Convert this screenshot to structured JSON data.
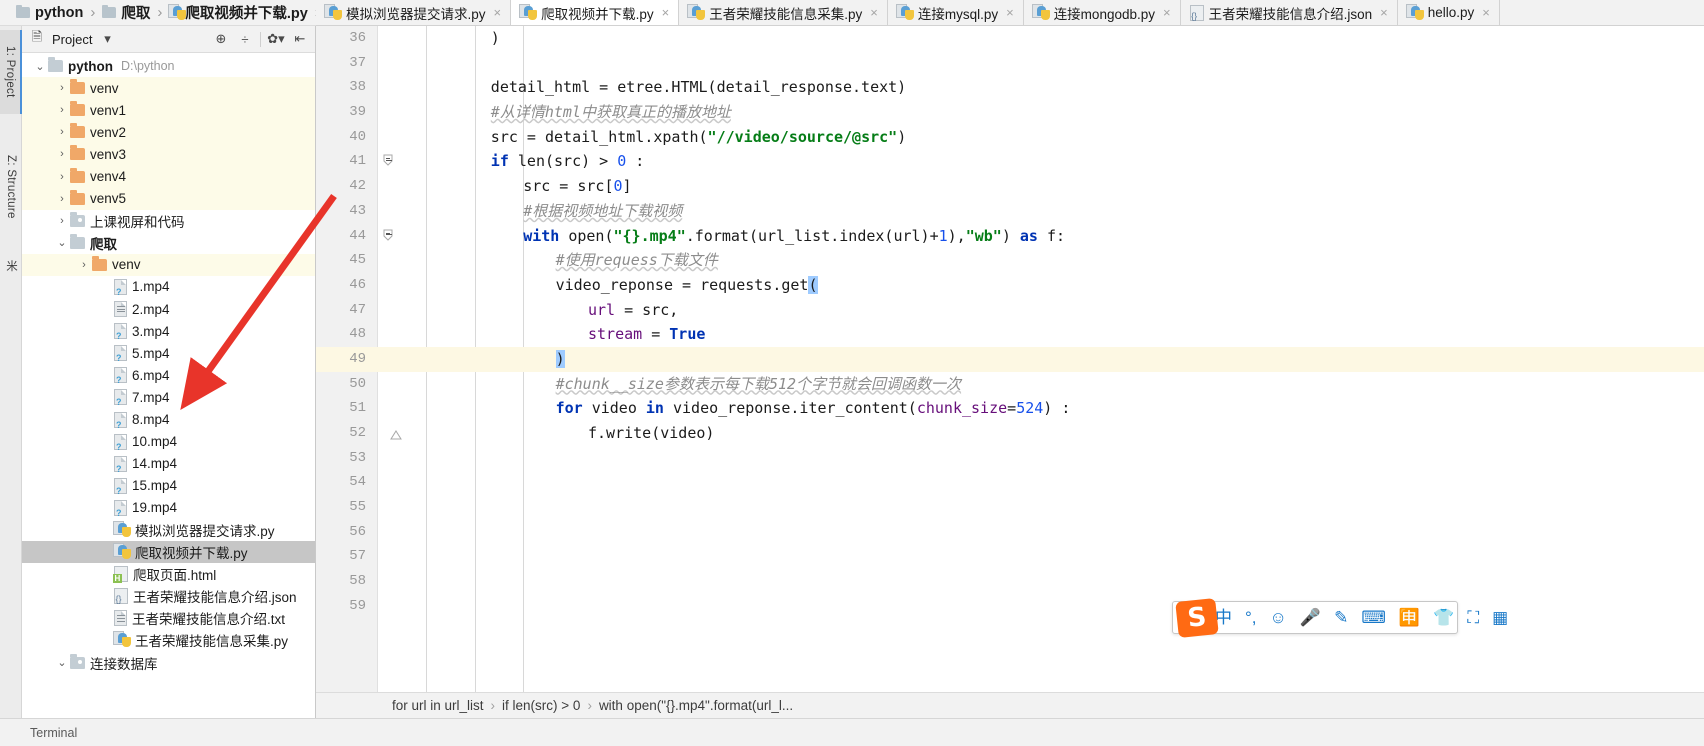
{
  "breadcrumb": {
    "items": [
      {
        "label": "python",
        "icon": "folder-icon"
      },
      {
        "label": "爬取",
        "icon": "folder-icon"
      },
      {
        "label": "爬取视频并下载.py",
        "icon": "python-file-icon"
      }
    ],
    "separator": "›"
  },
  "corner_tab": {
    "label": "连接mo"
  },
  "rail": {
    "project": "1: Project",
    "structure": "Z: Structure",
    "favorites": "米"
  },
  "panel": {
    "title": "Project",
    "dropdown_caret": "▾",
    "icons": [
      "target-icon",
      "collapse-all-icon",
      "gear-icon",
      "hide-panel-icon"
    ]
  },
  "tree": [
    {
      "id": "python-root",
      "label": "python",
      "path": "D:\\python",
      "indent": 0,
      "arrow": "⌄",
      "icon": "folder-closed",
      "bold": true,
      "bg": "none"
    },
    {
      "id": "venv",
      "label": "venv",
      "indent": 1,
      "arrow": "›",
      "icon": "folder-orange",
      "bg": "venv"
    },
    {
      "id": "venv1",
      "label": "venv1",
      "indent": 1,
      "arrow": "›",
      "icon": "folder-orange",
      "bg": "venv"
    },
    {
      "id": "venv2",
      "label": "venv2",
      "indent": 1,
      "arrow": "›",
      "icon": "folder-orange",
      "bg": "venv"
    },
    {
      "id": "venv3",
      "label": "venv3",
      "indent": 1,
      "arrow": "›",
      "icon": "folder-orange",
      "bg": "venv"
    },
    {
      "id": "venv4",
      "label": "venv4",
      "indent": 1,
      "arrow": "›",
      "icon": "folder-orange",
      "bg": "venv"
    },
    {
      "id": "venv5",
      "label": "venv5",
      "indent": 1,
      "arrow": "›",
      "icon": "folder-orange",
      "bg": "venv"
    },
    {
      "id": "shangke",
      "label": "上课视屏和代码",
      "indent": 1,
      "arrow": "›",
      "icon": "folder-module",
      "bg": "none"
    },
    {
      "id": "paqu",
      "label": "爬取",
      "indent": 1,
      "arrow": "⌄",
      "icon": "folder-closed",
      "bold": true,
      "bg": "none"
    },
    {
      "id": "paqu-venv",
      "label": "venv",
      "indent": 2,
      "arrow": "›",
      "icon": "folder-orange",
      "bg": "venv"
    },
    {
      "id": "mp4-1",
      "label": "1.mp4",
      "indent": 3,
      "arrow": "",
      "icon": "unknown-file",
      "bg": "none"
    },
    {
      "id": "mp4-2",
      "label": "2.mp4",
      "indent": 3,
      "arrow": "",
      "icon": "text-file",
      "bg": "none"
    },
    {
      "id": "mp4-3",
      "label": "3.mp4",
      "indent": 3,
      "arrow": "",
      "icon": "unknown-file",
      "bg": "none"
    },
    {
      "id": "mp4-5",
      "label": "5.mp4",
      "indent": 3,
      "arrow": "",
      "icon": "unknown-file",
      "bg": "none"
    },
    {
      "id": "mp4-6",
      "label": "6.mp4",
      "indent": 3,
      "arrow": "",
      "icon": "unknown-file",
      "bg": "none"
    },
    {
      "id": "mp4-7",
      "label": "7.mp4",
      "indent": 3,
      "arrow": "",
      "icon": "unknown-file",
      "bg": "none"
    },
    {
      "id": "mp4-8",
      "label": "8.mp4",
      "indent": 3,
      "arrow": "",
      "icon": "unknown-file",
      "bg": "none"
    },
    {
      "id": "mp4-10",
      "label": "10.mp4",
      "indent": 3,
      "arrow": "",
      "icon": "unknown-file",
      "bg": "none"
    },
    {
      "id": "mp4-14",
      "label": "14.mp4",
      "indent": 3,
      "arrow": "",
      "icon": "unknown-file",
      "bg": "none"
    },
    {
      "id": "mp4-15",
      "label": "15.mp4",
      "indent": 3,
      "arrow": "",
      "icon": "unknown-file",
      "bg": "none"
    },
    {
      "id": "mp4-19",
      "label": "19.mp4",
      "indent": 3,
      "arrow": "",
      "icon": "unknown-file",
      "bg": "none"
    },
    {
      "id": "py-moni",
      "label": "模拟浏览器提交请求.py",
      "indent": 3,
      "arrow": "",
      "icon": "python-file",
      "bg": "none"
    },
    {
      "id": "py-paqu",
      "label": "爬取视频并下载.py",
      "indent": 3,
      "arrow": "",
      "icon": "python-file",
      "bg": "selected"
    },
    {
      "id": "html-paqu",
      "label": "爬取页面.html",
      "indent": 3,
      "arrow": "",
      "icon": "html-file",
      "bg": "none"
    },
    {
      "id": "json-wz",
      "label": "王者荣耀技能信息介绍.json",
      "indent": 3,
      "arrow": "",
      "icon": "json-file",
      "bg": "none"
    },
    {
      "id": "txt-wz",
      "label": "王者荣耀技能信息介绍.txt",
      "indent": 3,
      "arrow": "",
      "icon": "text-file",
      "bg": "none"
    },
    {
      "id": "py-wz",
      "label": "王者荣耀技能信息采集.py",
      "indent": 3,
      "arrow": "",
      "icon": "python-file",
      "bg": "none"
    },
    {
      "id": "lianjie-db",
      "label": "连接数据库",
      "indent": 1,
      "arrow": "⌄",
      "icon": "folder-module",
      "bg": "none"
    }
  ],
  "tabs": [
    {
      "label": "模拟浏览器提交请求.py",
      "icon": "python-file",
      "active": false,
      "close": "×"
    },
    {
      "label": "爬取视频并下载.py",
      "icon": "python-file",
      "active": true,
      "close": "×"
    },
    {
      "label": "王者荣耀技能信息采集.py",
      "icon": "python-file",
      "active": false,
      "close": "×"
    },
    {
      "label": "连接mysql.py",
      "icon": "python-file",
      "active": false,
      "close": "×"
    },
    {
      "label": "连接mongodb.py",
      "icon": "python-file",
      "active": false,
      "close": "×"
    },
    {
      "label": "王者荣耀技能信息介绍.json",
      "icon": "json-file",
      "active": false,
      "close": "×"
    },
    {
      "label": "hello.py",
      "icon": "python-file",
      "active": false,
      "close": "×"
    }
  ],
  "code": {
    "first_line": 36,
    "current_line": 49,
    "lines": [
      {
        "n": 36,
        "indent": 8,
        "tokens": [
          {
            "t": ")",
            "c": "fn"
          }
        ]
      },
      {
        "n": 37,
        "indent": 0,
        "tokens": []
      },
      {
        "n": 38,
        "indent": 8,
        "tokens": [
          {
            "t": "detail_html = etree.HTML(detail_response.text)",
            "c": "fn"
          }
        ]
      },
      {
        "n": 39,
        "indent": 8,
        "tokens": [
          {
            "t": "#从详情html中获取真正的播放地址",
            "c": "cmt"
          }
        ]
      },
      {
        "n": 40,
        "indent": 8,
        "tokens": [
          {
            "t": "src = detail_html.xpath(",
            "c": "fn"
          },
          {
            "t": "\"//video/source/@src\"",
            "c": "str"
          },
          {
            "t": ")",
            "c": "fn"
          }
        ]
      },
      {
        "n": 41,
        "indent": 8,
        "fold": "minus",
        "tokens": [
          {
            "t": "if ",
            "c": "kw"
          },
          {
            "t": "len(src) > ",
            "c": "fn"
          },
          {
            "t": "0",
            "c": "num2"
          },
          {
            "t": " :",
            "c": "fn"
          }
        ]
      },
      {
        "n": 42,
        "indent": 12,
        "tokens": [
          {
            "t": "src = src[",
            "c": "fn"
          },
          {
            "t": "0",
            "c": "num2"
          },
          {
            "t": "]",
            "c": "fn"
          }
        ]
      },
      {
        "n": 43,
        "indent": 12,
        "tokens": [
          {
            "t": "#根据视频地址下载视频",
            "c": "cmt"
          }
        ]
      },
      {
        "n": 44,
        "indent": 12,
        "fold": "minus",
        "tokens": [
          {
            "t": "with ",
            "c": "kw"
          },
          {
            "t": "open(",
            "c": "fn"
          },
          {
            "t": "\"{}.mp4\"",
            "c": "str"
          },
          {
            "t": ".format(url_list.index(url)+",
            "c": "fn"
          },
          {
            "t": "1",
            "c": "num2"
          },
          {
            "t": "),",
            "c": "fn"
          },
          {
            "t": "\"wb\"",
            "c": "str"
          },
          {
            "t": ") ",
            "c": "fn"
          },
          {
            "t": "as ",
            "c": "kw"
          },
          {
            "t": "f:",
            "c": "fn"
          }
        ]
      },
      {
        "n": 45,
        "indent": 16,
        "tokens": [
          {
            "t": "#使用requess下载文件",
            "c": "cmt"
          }
        ]
      },
      {
        "n": 46,
        "indent": 16,
        "tokens": [
          {
            "t": "video_reponse = requests.get",
            "c": "fn"
          },
          {
            "t": "(",
            "c": "brk"
          }
        ]
      },
      {
        "n": 47,
        "indent": 20,
        "tokens": [
          {
            "t": "url",
            "c": "par"
          },
          {
            "t": " = src,",
            "c": "fn"
          }
        ]
      },
      {
        "n": 48,
        "indent": 20,
        "tokens": [
          {
            "t": "stream",
            "c": "par"
          },
          {
            "t": " = ",
            "c": "fn"
          },
          {
            "t": "True",
            "c": "kw"
          }
        ]
      },
      {
        "n": 49,
        "indent": 16,
        "tokens": [
          {
            "t": ")",
            "c": "brk"
          }
        ]
      },
      {
        "n": 50,
        "indent": 16,
        "tokens": [
          {
            "t": "#chunk__size参数表示每下载512个字节就会回调函数一次",
            "c": "cmt"
          }
        ]
      },
      {
        "n": 51,
        "indent": 16,
        "tokens": [
          {
            "t": "for ",
            "c": "kw"
          },
          {
            "t": "video ",
            "c": "fn"
          },
          {
            "t": "in ",
            "c": "kw"
          },
          {
            "t": "video_reponse.iter_content(",
            "c": "fn"
          },
          {
            "t": "chunk_size",
            "c": "par"
          },
          {
            "t": "=",
            "c": "fn"
          },
          {
            "t": "524",
            "c": "num2"
          },
          {
            "t": ") :",
            "c": "fn"
          }
        ]
      },
      {
        "n": 52,
        "indent": 20,
        "fold": "tri",
        "tokens": [
          {
            "t": "f.write(video)",
            "c": "fn"
          }
        ]
      },
      {
        "n": 53,
        "indent": 0,
        "tokens": []
      },
      {
        "n": 54,
        "indent": 0,
        "tokens": []
      },
      {
        "n": 55,
        "indent": 0,
        "tokens": []
      },
      {
        "n": 56,
        "indent": 0,
        "tokens": []
      },
      {
        "n": 57,
        "indent": 0,
        "tokens": []
      },
      {
        "n": 58,
        "indent": 0,
        "tokens": []
      },
      {
        "n": 59,
        "indent": 0,
        "tokens": []
      }
    ]
  },
  "bottom_breadcrumb": {
    "items": [
      "for url in url_list",
      "if len(src) > 0",
      "with open(\"{}.mp4\".format(url_l..."
    ],
    "separator": "›"
  },
  "ime": {
    "logo": "S",
    "items": [
      {
        "name": "chinese-mode-icon",
        "glyph": "中"
      },
      {
        "name": "punctuation-icon",
        "glyph": "°,"
      },
      {
        "name": "emoji-icon",
        "glyph": "☺"
      },
      {
        "name": "voice-input-icon",
        "glyph": "🎤"
      },
      {
        "name": "handwriting-icon",
        "glyph": "✎"
      },
      {
        "name": "soft-keyboard-icon",
        "glyph": "⌨"
      },
      {
        "name": "translate-icon",
        "glyph": "🈸"
      },
      {
        "name": "toolbox-icon",
        "glyph": "👕"
      },
      {
        "name": "screenshot-icon",
        "glyph": "⛶"
      },
      {
        "name": "apps-icon",
        "glyph": "▦"
      }
    ]
  },
  "statusbar": {
    "label": "Terminal"
  },
  "colors": {
    "keyword": "#0033b3",
    "string": "#067d17",
    "number": "#1750eb",
    "comment": "#8c8c8c",
    "param": "#660e7a",
    "caret_line": "#fdf8e3",
    "bracket_highlight": "#9ecbff",
    "selection": "#c6c6c6",
    "venv_row": "#fdfbe8",
    "arrow_annotation": "#e8342a"
  }
}
